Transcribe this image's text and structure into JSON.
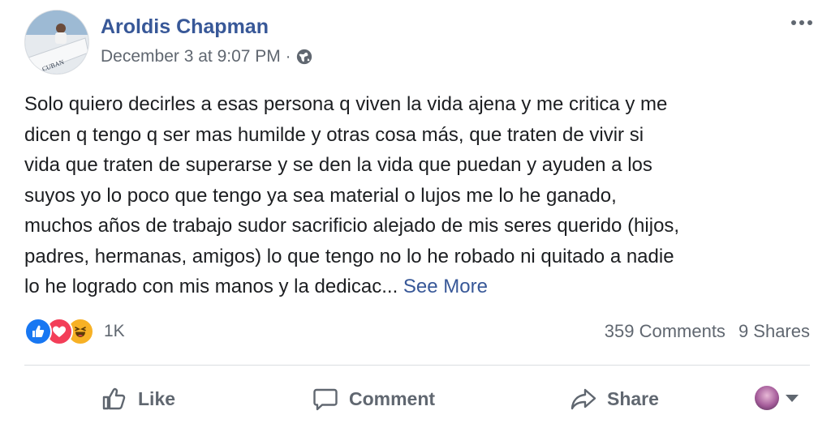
{
  "post": {
    "author": "Aroldis Chapman",
    "timestamp": "December 3 at 9:07 PM",
    "separator": "·",
    "privacy_icon": "globe-icon",
    "more_icon": "more-horizontal-icon",
    "text_lines": [
      "Solo quiero decirles a esas persona q viven la vida ajena y me critica y me",
      "dicen q tengo q ser mas humilde y otras cosa más, que traten de vivir si",
      "vida que traten de superarse y se den la vida que puedan y ayuden a los",
      "suyos yo lo poco que tengo ya sea material o lujos me lo he ganado,",
      "muchos años de trabajo sudor sacrificio alejado de mis seres querido (hijos,",
      "padres, hermanas, amigos) lo que tengo no lo he robado ni quitado a nadie",
      "lo he logrado con mis manos y la dedicac..."
    ],
    "see_more": "See More"
  },
  "reactions": {
    "icons": [
      "like-reaction-icon",
      "love-reaction-icon",
      "haha-reaction-icon"
    ],
    "count": "1K"
  },
  "stats": {
    "comments": "359 Comments",
    "shares": "9 Shares"
  },
  "actions": {
    "like": "Like",
    "comment": "Comment",
    "share": "Share"
  },
  "colors": {
    "author_link": "#385898",
    "meta_text": "#606770",
    "like_blue": "#1877f2",
    "love_red": "#f33e58",
    "haha_yellow": "#f7b125"
  }
}
